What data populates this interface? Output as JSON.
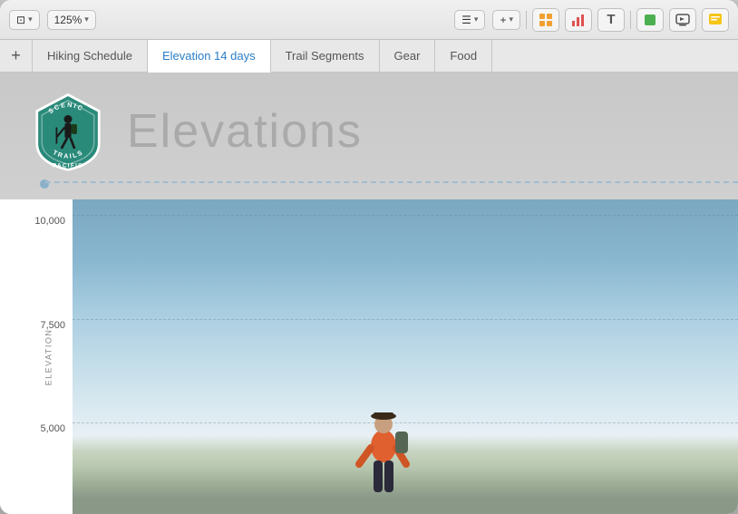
{
  "toolbar": {
    "view_label": "125%",
    "view_icon": "⊞",
    "list_icon": "≡",
    "add_icon": "+",
    "table_icon": "⊞",
    "chart_icon": "📊",
    "text_icon": "T",
    "shape_icon": "■",
    "media_icon": "🖼",
    "comment_icon": "■"
  },
  "tabs": {
    "add_label": "+",
    "items": [
      {
        "label": "Hiking Schedule",
        "active": false
      },
      {
        "label": "Elevation 14 days",
        "active": true
      },
      {
        "label": "Trail Segments",
        "active": false
      },
      {
        "label": "Gear",
        "active": false
      },
      {
        "label": "Food",
        "active": false
      }
    ]
  },
  "page": {
    "title": "Elevations",
    "logo_text": "SCENIC PACIFIC TRAILS"
  },
  "chart": {
    "y_axis_labels": [
      "10,000",
      "7,500",
      "5,000"
    ],
    "elevation_axis_label": "ELEVATION"
  }
}
